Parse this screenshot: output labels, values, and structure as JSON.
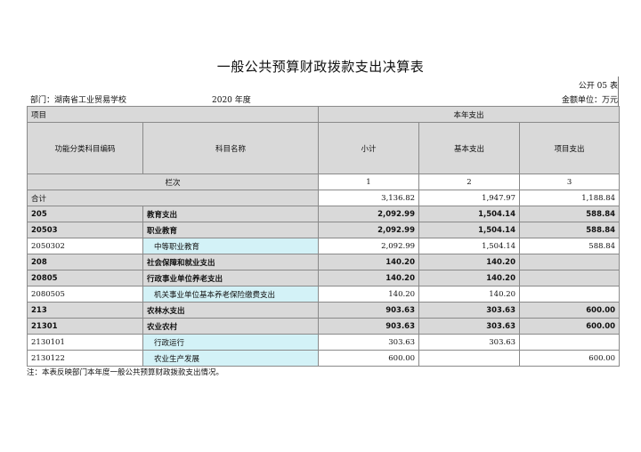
{
  "title": "一般公共预算财政拨款支出决算表",
  "form_no": "公开 05 表",
  "department": "部门：湖南省工业贸易学校",
  "year": "2020 年度",
  "unit": "金额单位：万元",
  "header": {
    "item": "项目",
    "current_year": "本年支出",
    "code": "功能分类科目编码",
    "name": "科目名称",
    "subtotal": "小计",
    "basic": "基本支出",
    "project": "项目支出",
    "column_no": "栏次",
    "col1": "1",
    "col2": "2",
    "col3": "3"
  },
  "total": {
    "label": "合计",
    "subtotal": "3,136.82",
    "basic": "1,947.97",
    "project": "1,188.84"
  },
  "rows": [
    {
      "code": "205",
      "name": "教育支出",
      "subtotal": "2,092.99",
      "basic": "1,504.14",
      "project": "588.84",
      "level": "class"
    },
    {
      "code": "20503",
      "name": "职业教育",
      "subtotal": "2,092.99",
      "basic": "1,504.14",
      "project": "588.84",
      "level": "class"
    },
    {
      "code": "2050302",
      "name": "中等职业教育",
      "subtotal": "2,092.99",
      "basic": "1,504.14",
      "project": "588.84",
      "level": "item"
    },
    {
      "code": "208",
      "name": "社会保障和就业支出",
      "subtotal": "140.20",
      "basic": "140.20",
      "project": "",
      "level": "class"
    },
    {
      "code": "20805",
      "name": "行政事业单位养老支出",
      "subtotal": "140.20",
      "basic": "140.20",
      "project": "",
      "level": "class"
    },
    {
      "code": "2080505",
      "name": "机关事业单位基本养老保险缴费支出",
      "subtotal": "140.20",
      "basic": "140.20",
      "project": "",
      "level": "item"
    },
    {
      "code": "213",
      "name": "农林水支出",
      "subtotal": "903.63",
      "basic": "303.63",
      "project": "600.00",
      "level": "class"
    },
    {
      "code": "21301",
      "name": "农业农村",
      "subtotal": "903.63",
      "basic": "303.63",
      "project": "600.00",
      "level": "class"
    },
    {
      "code": "2130101",
      "name": "行政运行",
      "subtotal": "303.63",
      "basic": "303.63",
      "project": "",
      "level": "item"
    },
    {
      "code": "2130122",
      "name": "农业生产发展",
      "subtotal": "600.00",
      "basic": "",
      "project": "600.00",
      "level": "item"
    }
  ],
  "note": "注：本表反映部门本年度一般公共预算财政拨款支出情况。"
}
